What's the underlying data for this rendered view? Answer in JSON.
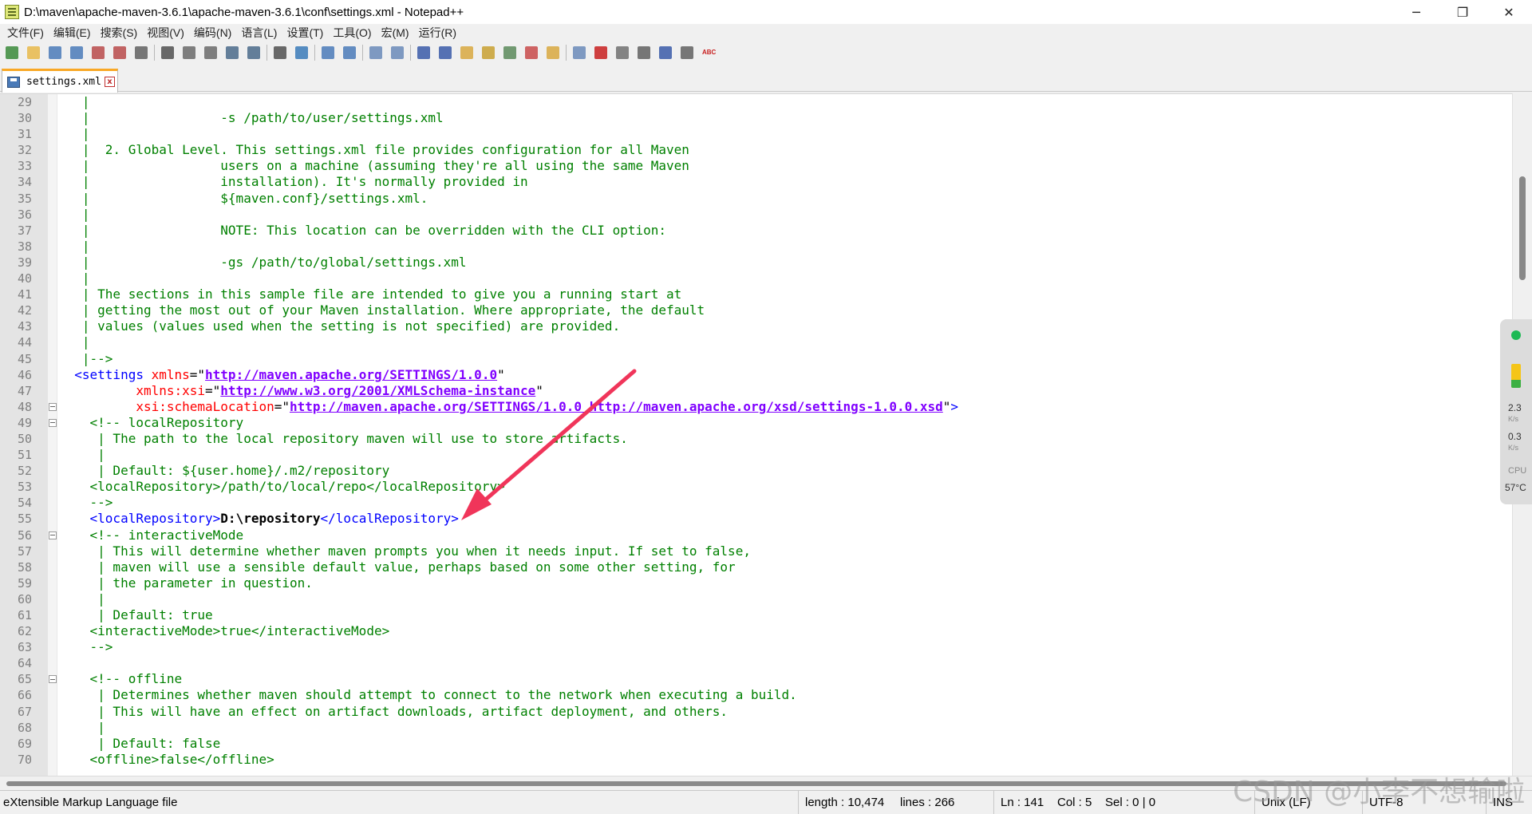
{
  "window": {
    "title": "D:\\maven\\apache-maven-3.6.1\\apache-maven-3.6.1\\conf\\settings.xml - Notepad++",
    "minimize": "─",
    "restore": "❐",
    "close": "✕"
  },
  "menu": [
    "文件(F)",
    "编辑(E)",
    "搜索(S)",
    "视图(V)",
    "编码(N)",
    "语言(L)",
    "设置(T)",
    "工具(O)",
    "宏(M)",
    "运行(R)"
  ],
  "toolbar": {
    "buttons": [
      "new",
      "open",
      "save",
      "save-all",
      "close",
      "close-all",
      "print",
      "cut",
      "copy",
      "paste",
      "undo",
      "redo",
      "find",
      "replace",
      "zoom-in",
      "zoom-out",
      "sync-v",
      "sync-h",
      "word-wrap",
      "show-all",
      "indent-guide",
      "udl",
      "doc-map",
      "function-list",
      "folder-workspace",
      "monitor",
      "record",
      "stop",
      "play",
      "play-multi",
      "save-macro",
      "spellcheck"
    ],
    "spellcheck_label": "ABC"
  },
  "tab": {
    "label": "settings.xml",
    "close": "x"
  },
  "editor": {
    "lines": [
      {
        "n": "29",
        "segs": [
          [
            "c",
            "   |"
          ]
        ]
      },
      {
        "n": "30",
        "segs": [
          [
            "c",
            "   |                 -s /path/to/user/settings.xml"
          ]
        ]
      },
      {
        "n": "31",
        "segs": [
          [
            "c",
            "   |"
          ]
        ]
      },
      {
        "n": "32",
        "segs": [
          [
            "c",
            "   |  2. Global Level. This settings.xml file provides configuration for all Maven"
          ]
        ]
      },
      {
        "n": "33",
        "segs": [
          [
            "c",
            "   |                 users on a machine (assuming they're all using the same Maven"
          ]
        ]
      },
      {
        "n": "34",
        "segs": [
          [
            "c",
            "   |                 installation). It's normally provided in"
          ]
        ]
      },
      {
        "n": "35",
        "segs": [
          [
            "c",
            "   |                 ${maven.conf}/settings.xml."
          ]
        ]
      },
      {
        "n": "36",
        "segs": [
          [
            "c",
            "   |"
          ]
        ]
      },
      {
        "n": "37",
        "segs": [
          [
            "c",
            "   |                 NOTE: This location can be overridden with the CLI option:"
          ]
        ]
      },
      {
        "n": "38",
        "segs": [
          [
            "c",
            "   |"
          ]
        ]
      },
      {
        "n": "39",
        "segs": [
          [
            "c",
            "   |                 -gs /path/to/global/settings.xml"
          ]
        ]
      },
      {
        "n": "40",
        "segs": [
          [
            "c",
            "   |"
          ]
        ]
      },
      {
        "n": "41",
        "segs": [
          [
            "c",
            "   | The sections in this sample file are intended to give you a running start at"
          ]
        ]
      },
      {
        "n": "42",
        "segs": [
          [
            "c",
            "   | getting the most out of your Maven installation. Where appropriate, the default"
          ]
        ]
      },
      {
        "n": "43",
        "segs": [
          [
            "c",
            "   | values (values used when the setting is not specified) are provided."
          ]
        ]
      },
      {
        "n": "44",
        "segs": [
          [
            "c",
            "   |"
          ]
        ]
      },
      {
        "n": "45",
        "segs": [
          [
            "c",
            "   |-->"
          ]
        ]
      },
      {
        "n": "46",
        "segs": [
          [
            "t",
            "  <settings "
          ],
          [
            "a",
            "xmlns"
          ],
          [
            "p",
            "=\""
          ],
          [
            "s",
            "http://maven.apache.org/SETTINGS/1.0.0"
          ],
          [
            "p",
            "\""
          ]
        ]
      },
      {
        "n": "47",
        "segs": [
          [
            "a",
            "          xmlns:xsi"
          ],
          [
            "p",
            "=\""
          ],
          [
            "s",
            "http://www.w3.org/2001/XMLSchema-instance"
          ],
          [
            "p",
            "\""
          ]
        ]
      },
      {
        "n": "48",
        "fold": true,
        "segs": [
          [
            "a",
            "          xsi:schemaLocation"
          ],
          [
            "p",
            "=\""
          ],
          [
            "s",
            "http://maven.apache.org/SETTINGS/1.0.0 http://maven.apache.org/xsd/settings-1.0.0.xsd"
          ],
          [
            "p",
            "\""
          ],
          [
            "t",
            ">"
          ]
        ]
      },
      {
        "n": "49",
        "fold": true,
        "segs": [
          [
            "c",
            "    <!-- localRepository"
          ]
        ]
      },
      {
        "n": "50",
        "segs": [
          [
            "c",
            "     | The path to the local repository maven will use to store artifacts."
          ]
        ]
      },
      {
        "n": "51",
        "segs": [
          [
            "c",
            "     |"
          ]
        ]
      },
      {
        "n": "52",
        "segs": [
          [
            "c",
            "     | Default: ${user.home}/.m2/repository"
          ]
        ]
      },
      {
        "n": "53",
        "segs": [
          [
            "c",
            "    <localRepository>/path/to/local/repo</localRepository>"
          ]
        ]
      },
      {
        "n": "54",
        "segs": [
          [
            "c",
            "    -->"
          ]
        ]
      },
      {
        "n": "55",
        "segs": [
          [
            "t",
            "    <localRepository>"
          ],
          [
            "b",
            "D:\\repository"
          ],
          [
            "t",
            "</localRepository>"
          ]
        ]
      },
      {
        "n": "56",
        "fold": true,
        "segs": [
          [
            "c",
            "    <!-- interactiveMode"
          ]
        ]
      },
      {
        "n": "57",
        "segs": [
          [
            "c",
            "     | This will determine whether maven prompts you when it needs input. If set to false,"
          ]
        ]
      },
      {
        "n": "58",
        "segs": [
          [
            "c",
            "     | maven will use a sensible default value, perhaps based on some other setting, for"
          ]
        ]
      },
      {
        "n": "59",
        "segs": [
          [
            "c",
            "     | the parameter in question."
          ]
        ]
      },
      {
        "n": "60",
        "segs": [
          [
            "c",
            "     |"
          ]
        ]
      },
      {
        "n": "61",
        "segs": [
          [
            "c",
            "     | Default: true"
          ]
        ]
      },
      {
        "n": "62",
        "segs": [
          [
            "c",
            "    <interactiveMode>true</interactiveMode>"
          ]
        ]
      },
      {
        "n": "63",
        "segs": [
          [
            "c",
            "    -->"
          ]
        ]
      },
      {
        "n": "64",
        "segs": [
          [
            "c",
            ""
          ]
        ]
      },
      {
        "n": "65",
        "fold": true,
        "segs": [
          [
            "c",
            "    <!-- offline"
          ]
        ]
      },
      {
        "n": "66",
        "segs": [
          [
            "c",
            "     | Determines whether maven should attempt to connect to the network when executing a build."
          ]
        ]
      },
      {
        "n": "67",
        "segs": [
          [
            "c",
            "     | This will have an effect on artifact downloads, artifact deployment, and others."
          ]
        ]
      },
      {
        "n": "68",
        "segs": [
          [
            "c",
            "     |"
          ]
        ]
      },
      {
        "n": "69",
        "segs": [
          [
            "c",
            "     | Default: false"
          ]
        ]
      },
      {
        "n": "70",
        "segs": [
          [
            "c",
            "    <offline>false</offline>"
          ]
        ]
      }
    ]
  },
  "statusbar": {
    "type": "eXtensible Markup Language file",
    "length": "length : 10,474",
    "lines": "lines : 266",
    "ln": "Ln : 141",
    "col": "Col : 5",
    "sel": "Sel : 0 | 0",
    "eol": "Unix (LF)",
    "encoding": "UTF-8",
    "mode": "INS"
  },
  "netwidget": {
    "up_value": "2.3",
    "up_unit": "K/s",
    "down_value": "0.3",
    "down_unit": "K/s",
    "cpu_label": "CPU",
    "cpu_temp": "57°C"
  },
  "watermark": "CSDN @小李不想输啦",
  "colors": {
    "comment": "#008000",
    "tag": "#0000ff",
    "attribute": "#ff0000",
    "string": "#8000ff",
    "arrow": "#f0355a",
    "tab_accent": "#f9a825"
  }
}
